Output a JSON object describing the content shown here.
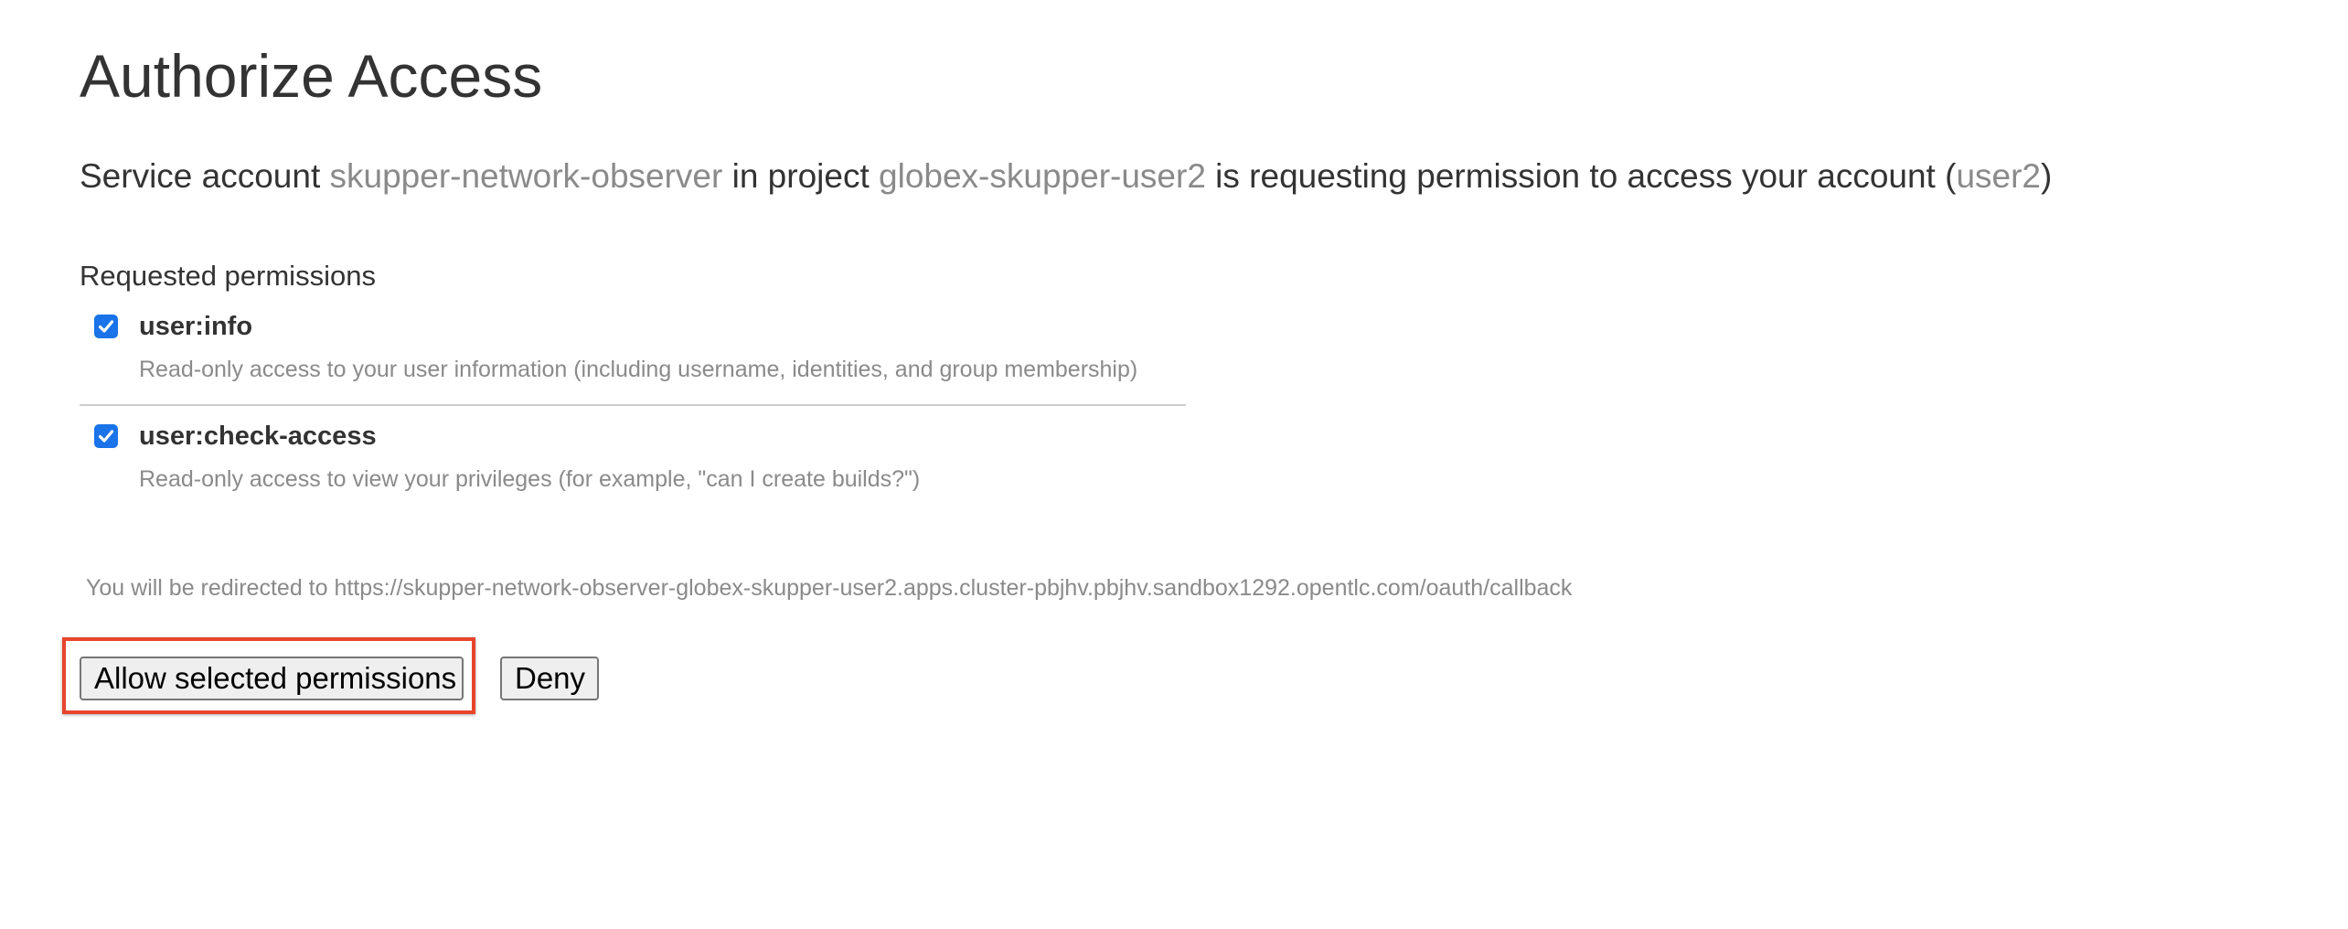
{
  "page": {
    "title": "Authorize Access"
  },
  "request": {
    "prefix": "Service account ",
    "service_account": "skupper-network-observer",
    "middle": " in project ",
    "project": "globex-skupper-user2",
    "suffix": " is requesting permission to access your account (",
    "account": "user2",
    "close": ")"
  },
  "permissions": {
    "heading": "Requested permissions",
    "items": [
      {
        "name": "user:info",
        "description": "Read-only access to your user information (including username, identities, and group membership)",
        "checked": true
      },
      {
        "name": "user:check-access",
        "description": "Read-only access to view your privileges (for example, \"can I create builds?\")",
        "checked": true
      }
    ]
  },
  "redirect": {
    "text": "You will be redirected to https://skupper-network-observer-globex-skupper-user2.apps.cluster-pbjhv.pbjhv.sandbox1292.opentlc.com/oauth/callback"
  },
  "actions": {
    "allow_label": "Allow selected permissions",
    "deny_label": "Deny"
  },
  "colors": {
    "checkbox": "#1a73e8",
    "highlight": "#e8452c",
    "muted_text": "#8a8a8a"
  }
}
